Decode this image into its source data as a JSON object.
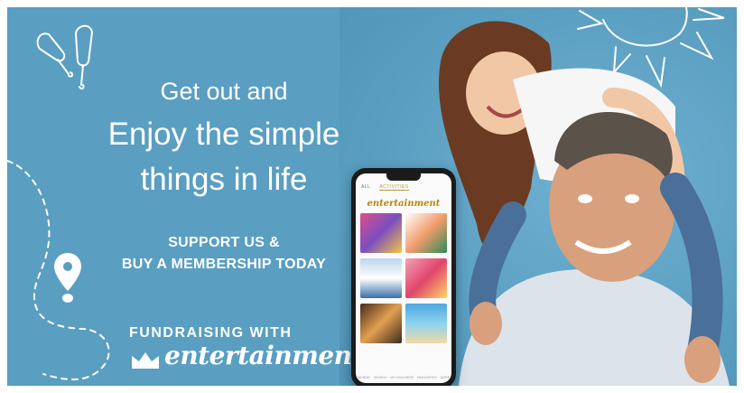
{
  "headline": {
    "line1": "Get out and",
    "line2": "Enjoy the simple",
    "line3": "things in life"
  },
  "cta": {
    "line1": "SUPPORT US &",
    "line2": "BUY A MEMBERSHIP TODAY"
  },
  "fundraising": {
    "label": "FUNDRAISING WITH",
    "brand": "entertainment."
  },
  "app": {
    "tabs": [
      "ALL",
      "ACTIVITIES"
    ],
    "logo": "entertainment",
    "nav": [
      "NEARBY",
      "SEARCH",
      "MY VOUCHERS",
      "FAVOURITES",
      "MORE"
    ]
  },
  "colors": {
    "background": "#5a9ec1",
    "brand_gold": "#b8860b"
  },
  "icons": [
    "ice-cream-icon",
    "sun-icon",
    "location-pin-icon",
    "crown-icon"
  ]
}
